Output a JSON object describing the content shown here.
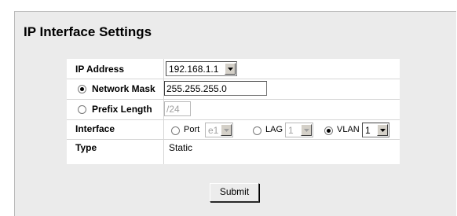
{
  "page": {
    "title": "IP Interface Settings"
  },
  "form": {
    "ip_address": {
      "label": "IP Address",
      "value": "192.168.1.1"
    },
    "network_mask": {
      "label": "Network Mask",
      "value": "255.255.255.0",
      "selected": true
    },
    "prefix_length": {
      "label": "Prefix Length",
      "value": "/24",
      "selected": false
    },
    "interface": {
      "label": "Interface",
      "port": {
        "label": "Port",
        "value": "e1",
        "selected": false
      },
      "lag": {
        "label": "LAG",
        "value": "1",
        "selected": false
      },
      "vlan": {
        "label": "VLAN",
        "value": "1",
        "selected": true
      }
    },
    "type": {
      "label": "Type",
      "value": "Static"
    }
  },
  "actions": {
    "submit_label": "Submit"
  }
}
